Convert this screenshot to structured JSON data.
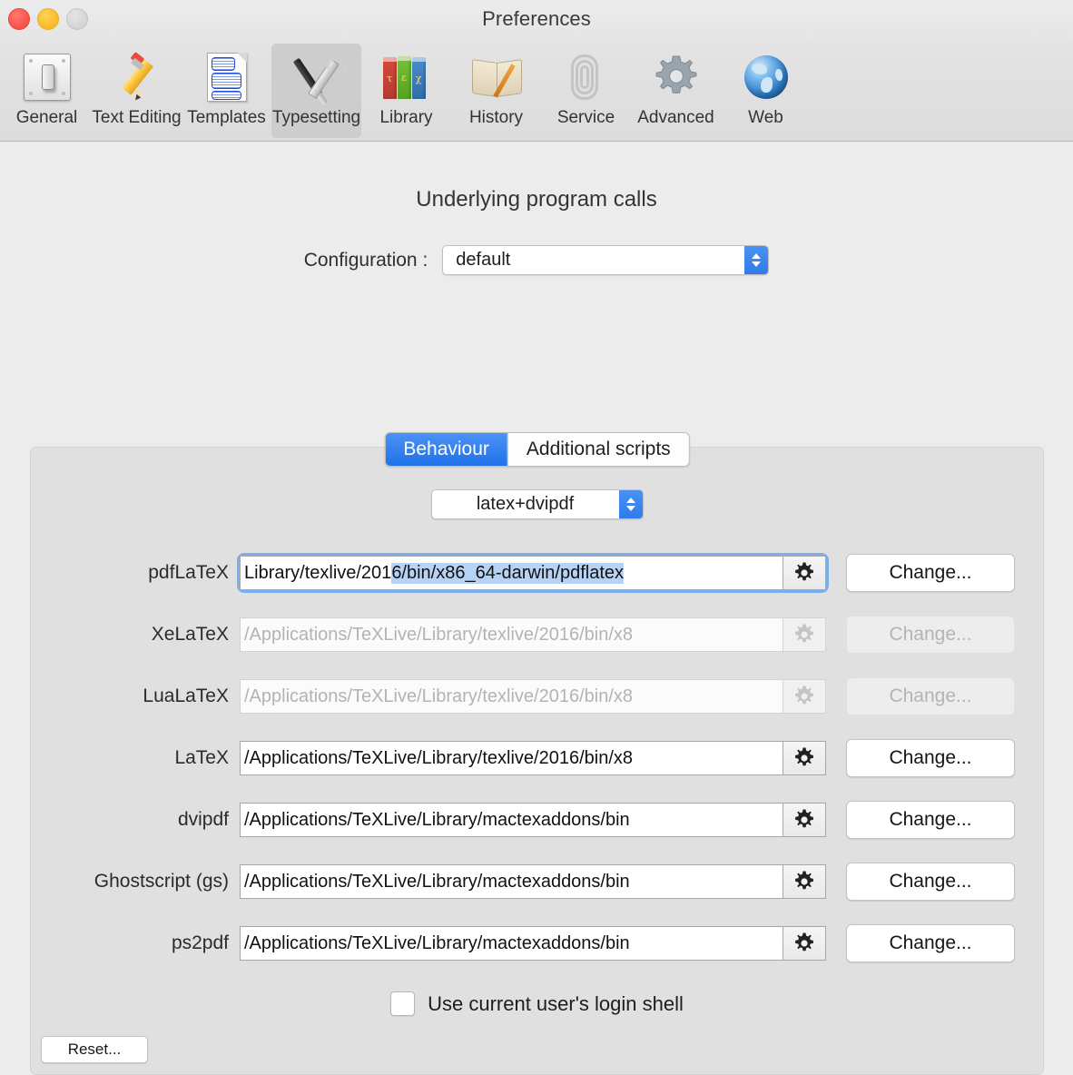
{
  "window": {
    "title": "Preferences",
    "traffic_lights": [
      {
        "name": "close",
        "color": "#f9564d"
      },
      {
        "name": "minimize",
        "color": "#fbbd2e"
      },
      {
        "name": "zoom",
        "color": "#d6d6d6"
      }
    ]
  },
  "toolbar": {
    "items": [
      {
        "label": "General",
        "icon": "switch-icon",
        "selected": false
      },
      {
        "label": "Text Editing",
        "icon": "pencil-icon",
        "selected": false
      },
      {
        "label": "Templates",
        "icon": "document-icon",
        "selected": false
      },
      {
        "label": "Typesetting",
        "icon": "tools-icon",
        "selected": true
      },
      {
        "label": "Library",
        "icon": "books-icon",
        "selected": false
      },
      {
        "label": "History",
        "icon": "open-book-icon",
        "selected": false
      },
      {
        "label": "Service",
        "icon": "paperclip-icon",
        "selected": false
      },
      {
        "label": "Advanced",
        "icon": "gear-icon",
        "selected": false
      },
      {
        "label": "Web",
        "icon": "globe-icon",
        "selected": false
      }
    ]
  },
  "section": {
    "title": "Underlying program calls",
    "configuration_label": "Configuration :",
    "configuration_value": "default"
  },
  "tabs": [
    {
      "label": "Behaviour",
      "active": true
    },
    {
      "label": "Additional scripts",
      "active": false
    }
  ],
  "engine": {
    "value": "latex+dvipdf"
  },
  "rows": [
    {
      "label": "pdfLaTeX",
      "value_prefix": "Library/texlive/201",
      "value_selected": "6/bin/x86_64-darwin/pdflatex",
      "full_value": "Library/texlive/2016/bin/x86_64-darwin/pdflatex",
      "disabled": false,
      "focused": true,
      "button_label": "Change..."
    },
    {
      "label": "XeLaTeX",
      "full_value": "/Applications/TeXLive/Library/texlive/2016/bin/x8",
      "disabled": true,
      "focused": false,
      "button_label": "Change..."
    },
    {
      "label": "LuaLaTeX",
      "full_value": "/Applications/TeXLive/Library/texlive/2016/bin/x8",
      "disabled": true,
      "focused": false,
      "button_label": "Change..."
    },
    {
      "label": "LaTeX",
      "full_value": "/Applications/TeXLive/Library/texlive/2016/bin/x8",
      "disabled": false,
      "focused": false,
      "button_label": "Change..."
    },
    {
      "label": "dvipdf",
      "full_value": "/Applications/TeXLive/Library/mactexaddons/bin",
      "disabled": false,
      "focused": false,
      "button_label": "Change..."
    },
    {
      "label": "Ghostscript (gs)",
      "full_value": "/Applications/TeXLive/Library/mactexaddons/bin",
      "disabled": false,
      "focused": false,
      "button_label": "Change..."
    },
    {
      "label": "ps2pdf",
      "full_value": "/Applications/TeXLive/Library/mactexaddons/bin",
      "disabled": false,
      "focused": false,
      "button_label": "Change..."
    }
  ],
  "footer": {
    "shell_checkbox_label": "Use current user's login shell",
    "shell_checkbox_checked": false,
    "reset_label": "Reset..."
  },
  "colors": {
    "accent_blue": "#2f7bea",
    "selection_blue": "#b6d3f5",
    "focus_ring": "#79aeef",
    "window_bg": "#ececec",
    "panel_bg": "#e0e0e0",
    "toolbar_bg": "#dcdcdc"
  }
}
